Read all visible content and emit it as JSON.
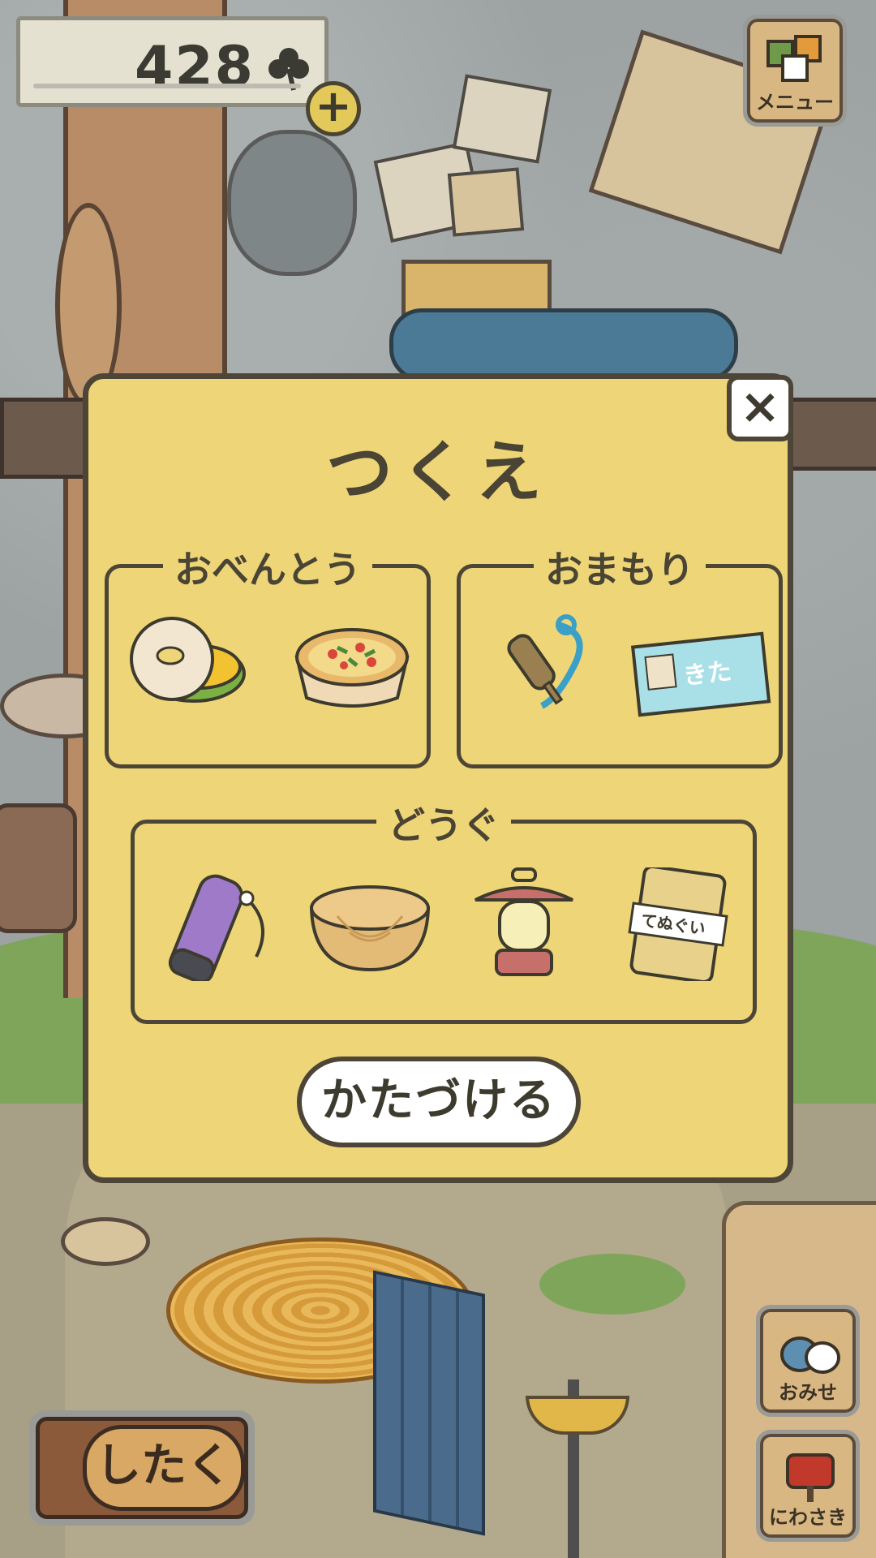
{
  "hud": {
    "coin_count": "428",
    "coin_icon": "clover-icon",
    "plus_label": "+",
    "menu_label": "メニュー",
    "shop_label": "おみせ",
    "garden_label": "にわさき",
    "prepare_label": "したく"
  },
  "dialog": {
    "title": "つくえ",
    "close_label": "×",
    "groups": {
      "lunch": {
        "label": "おべんとう",
        "items": [
          "bagel-sandwich-icon",
          "quiche-icon"
        ]
      },
      "charm": {
        "label": "おまもり",
        "items": [
          "bell-charm-icon",
          "ticket-charm-icon"
        ],
        "ticket_text": "きた"
      },
      "tool": {
        "label": "どうぐ",
        "items": [
          "water-bottle-icon",
          "wooden-bowl-icon",
          "lantern-icon",
          "tenugui-icon"
        ],
        "tenugui_text": "てぬぐい"
      }
    },
    "cleanup_label": "かたづける"
  },
  "colors": {
    "dialog_bg": "#eed577",
    "outline": "#4d4638",
    "button_bg": "#ffffff"
  }
}
